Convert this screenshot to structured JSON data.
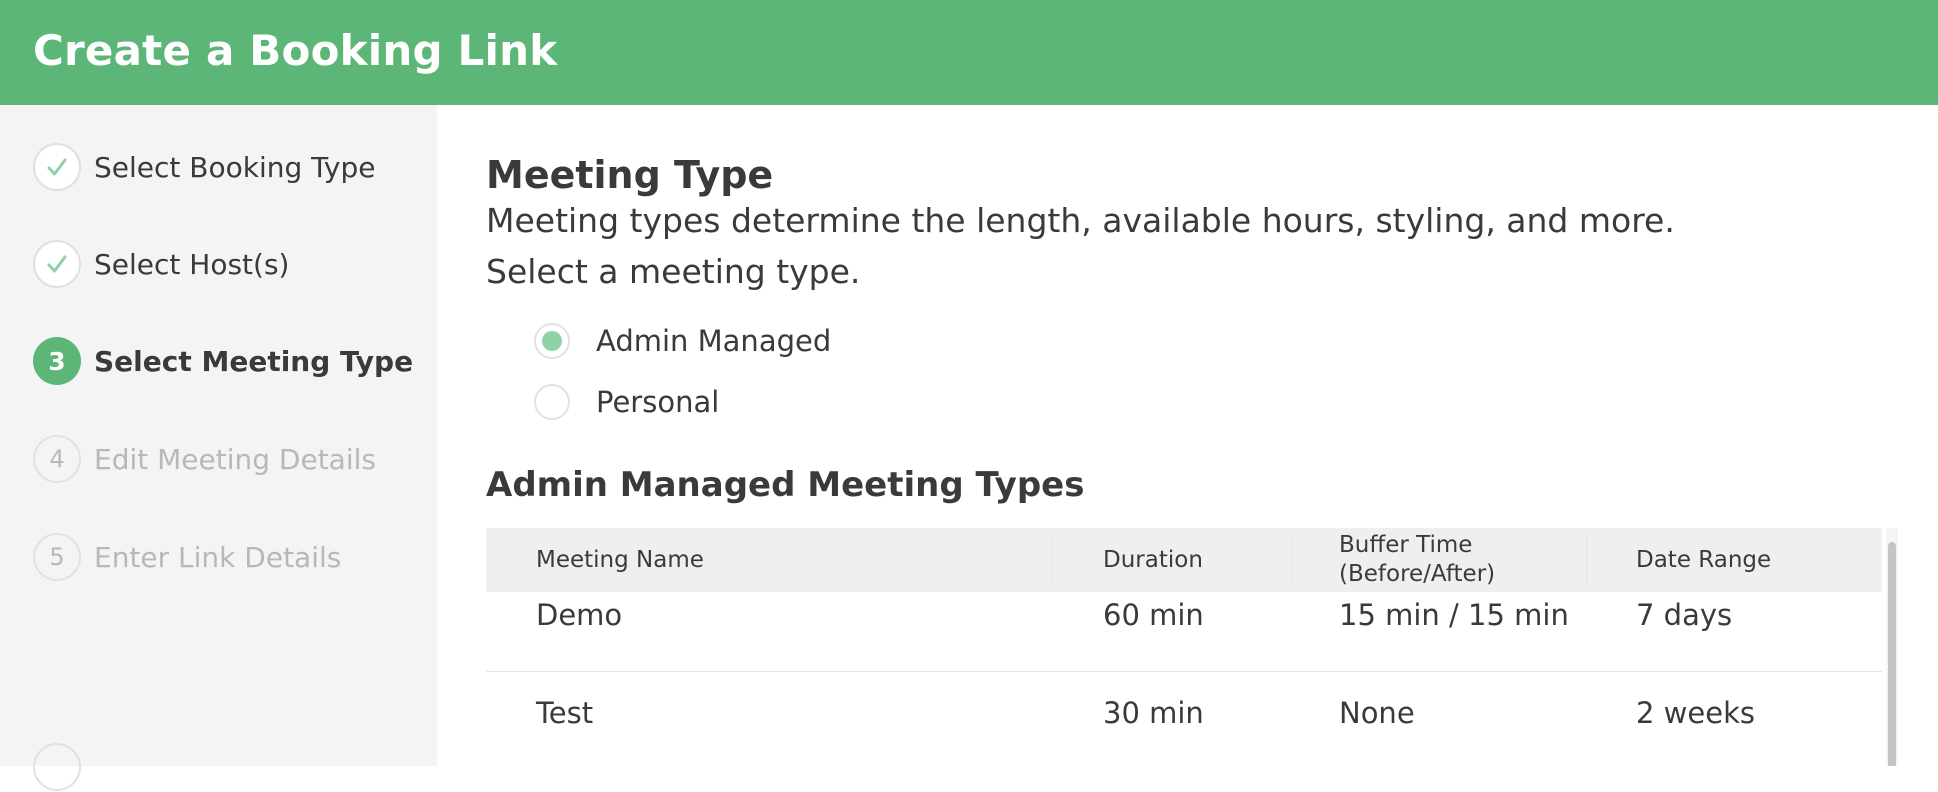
{
  "header": {
    "title": "Create a Booking Link"
  },
  "colors": {
    "brand": "#5cb677",
    "radio_selected": "#8fd1a5"
  },
  "steps": [
    {
      "marker": "check-icon",
      "label": "Select Booking Type",
      "state": "done"
    },
    {
      "marker": "check-icon",
      "label": "Select Host(s)",
      "state": "done"
    },
    {
      "marker": "3",
      "label": "Select Meeting Type",
      "state": "current"
    },
    {
      "marker": "4",
      "label": "Edit Meeting Details",
      "state": "future"
    },
    {
      "marker": "5",
      "label": "Enter Link Details",
      "state": "future"
    }
  ],
  "main": {
    "title": "Meeting Type",
    "description": "Meeting types determine the length, available hours, styling, and more.",
    "prompt": "Select a meeting type.",
    "options": [
      {
        "label": "Admin Managed",
        "selected": true
      },
      {
        "label": "Personal",
        "selected": false
      }
    ],
    "table_title": "Admin Managed Meeting Types",
    "table": {
      "headers": [
        "Meeting Name",
        "Duration",
        "Buffer Time\n(Before/After)",
        "Date Range"
      ],
      "rows": [
        [
          "Demo",
          "60 min",
          "15 min / 15 min",
          "7 days"
        ],
        [
          "Test",
          "30 min",
          "None",
          "2 weeks"
        ]
      ]
    }
  }
}
